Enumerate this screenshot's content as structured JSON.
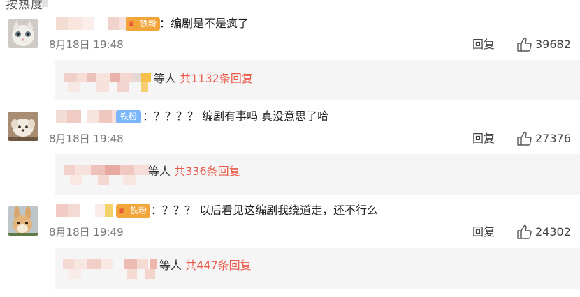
{
  "header": {
    "cut_text": "按热度"
  },
  "comments": [
    {
      "badge": "铁粉",
      "text": "：编剧是不是疯了",
      "time": "8月18日 19:48",
      "reply_label": "回复",
      "likes": "39682",
      "sub": {
        "who": "等人",
        "count": "共1132条回复"
      }
    },
    {
      "badge": "铁粉",
      "text": "：？？？？ 编剧有事吗 真没意思了哈",
      "time": "8月18日 19:48",
      "reply_label": "回复",
      "likes": "27376",
      "sub": {
        "who": "等人",
        "count": "共336条回复"
      }
    },
    {
      "badge": "铁粉",
      "text": "：？？？ 以后看见这编剧我绕道走，还不行么",
      "time": "8月18日 19:49",
      "reply_label": "回复",
      "likes": "24302",
      "sub": {
        "who": "等人",
        "count": "共447条回复"
      }
    }
  ],
  "colors": {
    "badge_blue": "#7ab6ff",
    "badge_orange": "#f2a53b",
    "reply_count": "#ea5a4a",
    "sub_background": "#f5f5f5"
  },
  "icons": [
    "like-thumb-icon",
    "fan-badge-icon"
  ]
}
